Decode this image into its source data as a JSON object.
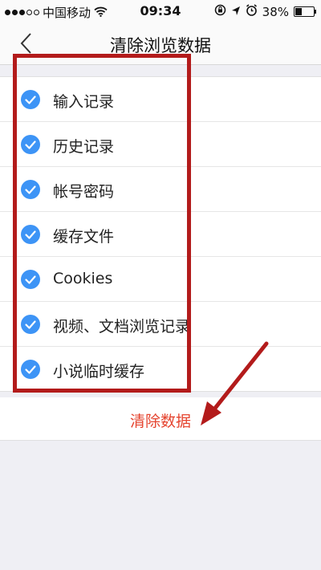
{
  "status_bar": {
    "carrier": "中国移动",
    "time": "09:34",
    "battery_text": "38%",
    "battery_level": 0.38,
    "icons": [
      "signal-dots-icon",
      "wifi-icon",
      "rotation-lock-icon",
      "location-arrow-icon",
      "alarm-icon",
      "battery-icon"
    ]
  },
  "nav": {
    "title": "清除浏览数据",
    "back_icon": "chevron-left-icon"
  },
  "options": [
    {
      "label": "输入记录",
      "checked": true
    },
    {
      "label": "历史记录",
      "checked": true
    },
    {
      "label": "帐号密码",
      "checked": true
    },
    {
      "label": "缓存文件",
      "checked": true
    },
    {
      "label": "Cookies",
      "checked": true
    },
    {
      "label": "视频、文档浏览记录",
      "checked": true
    },
    {
      "label": "小说临时缓存",
      "checked": true
    }
  ],
  "clear_button": {
    "label": "清除数据"
  },
  "colors": {
    "check": "#3d94f6",
    "clear_text": "#e5442f",
    "annotation": "#b31b1b"
  }
}
